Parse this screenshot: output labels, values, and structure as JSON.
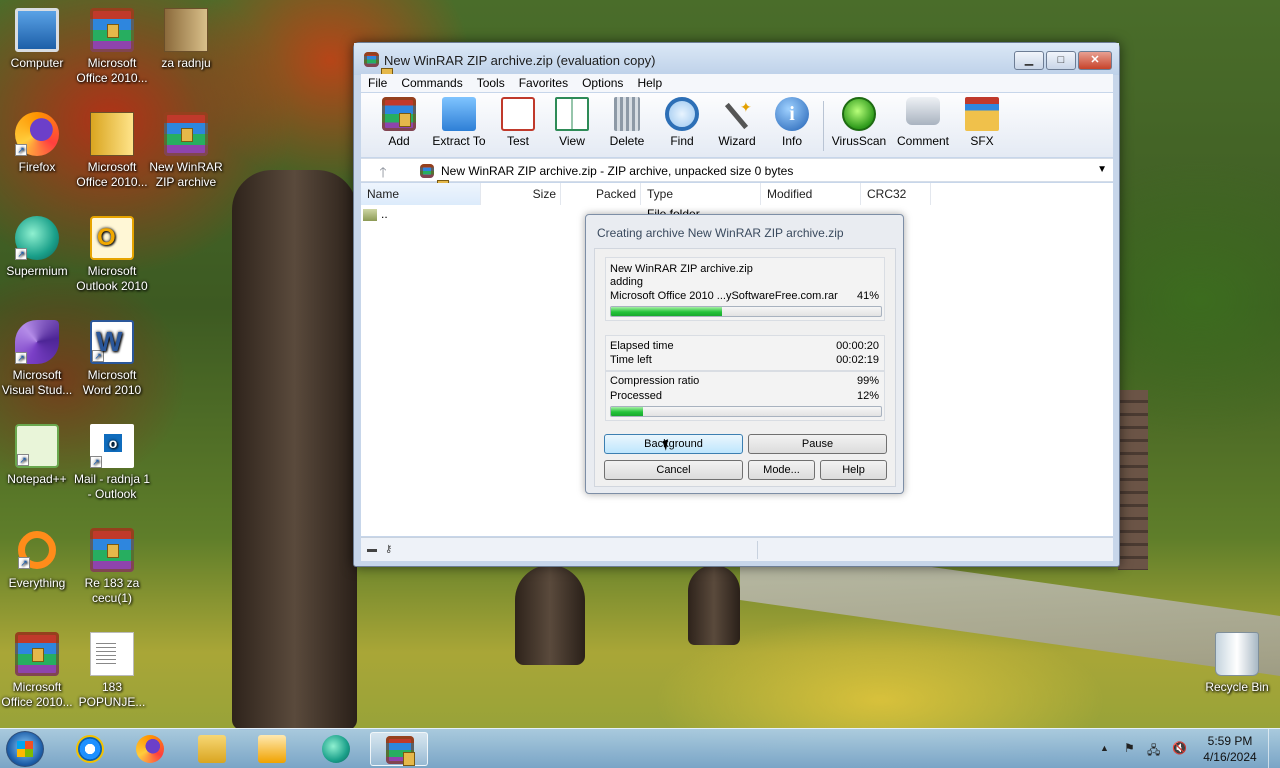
{
  "desktop": {
    "icons": [
      {
        "label": "Computer",
        "icon": "computer-icon"
      },
      {
        "label": "Microsoft Office 2010...",
        "icon": "winrar-archive-icon"
      },
      {
        "label": "za radnju",
        "icon": "folder-icon"
      },
      {
        "label": "Firefox",
        "icon": "firefox-icon"
      },
      {
        "label": "Microsoft Office 2010...",
        "icon": "office-folder-icon"
      },
      {
        "label": "New WinRAR ZIP archive",
        "icon": "winrar-archive-icon"
      },
      {
        "label": "Supermium",
        "icon": "supermium-icon"
      },
      {
        "label": "Microsoft Outlook 2010",
        "icon": "outlook-icon"
      },
      {
        "label": "Microsoft Visual Stud...",
        "icon": "visual-studio-icon"
      },
      {
        "label": "Microsoft Word 2010",
        "icon": "word-icon"
      },
      {
        "label": "Notepad++",
        "icon": "notepadpp-icon"
      },
      {
        "label": "Mail - radnja 1 - Outlook",
        "icon": "outlook-mail-icon"
      },
      {
        "label": "Everything",
        "icon": "everything-icon"
      },
      {
        "label": "Re 183 za cecu(1)",
        "icon": "winrar-archive-icon"
      },
      {
        "label": "Microsoft Office 2010...",
        "icon": "winrar-archive-icon"
      },
      {
        "label": "183 POPUNJE...",
        "icon": "document-icon"
      },
      {
        "label": "Recycle Bin",
        "icon": "recycle-bin-icon"
      }
    ]
  },
  "window": {
    "title": "New WinRAR ZIP archive.zip (evaluation copy)",
    "controls": {
      "minimize": "▁",
      "maximize": "□",
      "close": "✕"
    },
    "menu": [
      "File",
      "Commands",
      "Tools",
      "Favorites",
      "Options",
      "Help"
    ],
    "toolbar": [
      {
        "label": "Add",
        "icon": "add-books-icon"
      },
      {
        "label": "Extract To",
        "icon": "extract-folder-icon"
      },
      {
        "label": "Test",
        "icon": "test-checklist-icon"
      },
      {
        "label": "View",
        "icon": "view-book-icon"
      },
      {
        "label": "Delete",
        "icon": "delete-bin-icon"
      },
      {
        "label": "Find",
        "icon": "find-magnifier-icon"
      },
      {
        "label": "Wizard",
        "icon": "wizard-wand-icon"
      },
      {
        "label": "Info",
        "icon": "info-icon"
      },
      {
        "label": "VirusScan",
        "icon": "virusscan-icon"
      },
      {
        "label": "Comment",
        "icon": "comment-icon"
      },
      {
        "label": "SFX",
        "icon": "sfx-box-icon"
      }
    ],
    "address": {
      "up": "🡑",
      "text": "New WinRAR ZIP archive.zip - ZIP archive, unpacked size 0 bytes",
      "dropdown": "▼"
    },
    "columns": [
      "Name",
      "Size",
      "Packed",
      "Type",
      "Modified",
      "CRC32"
    ],
    "rows": [
      {
        "name": "..",
        "type": "File folder"
      }
    ]
  },
  "dialog": {
    "title": "Creating archive New WinRAR ZIP archive.zip",
    "archive": "New WinRAR ZIP archive.zip",
    "action": "adding",
    "file": "Microsoft Office 2010 ...ySoftwareFree.com.rar",
    "file_percent": "41%",
    "file_progress": 0.41,
    "elapsed_label": "Elapsed time",
    "elapsed_value": "00:00:20",
    "left_label": "Time left",
    "left_value": "00:02:19",
    "ratio_label": "Compression ratio",
    "ratio_value": "99%",
    "processed_label": "Processed",
    "processed_value": "12%",
    "processed_progress": 0.12,
    "buttons": {
      "background": "Background",
      "pause": "Pause",
      "cancel": "Cancel",
      "mode": "Mode...",
      "help": "Help"
    }
  },
  "taskbar": {
    "apps": [
      "internet-explorer-icon",
      "firefox-icon",
      "file-explorer-icon",
      "media-player-icon",
      "supermium-icon",
      "winrar-icon"
    ],
    "tray": {
      "chevron": "▲",
      "flag": "⚑",
      "network": "🖧",
      "volume": "🔇"
    },
    "time": "5:59 PM",
    "date": "4/16/2024"
  }
}
